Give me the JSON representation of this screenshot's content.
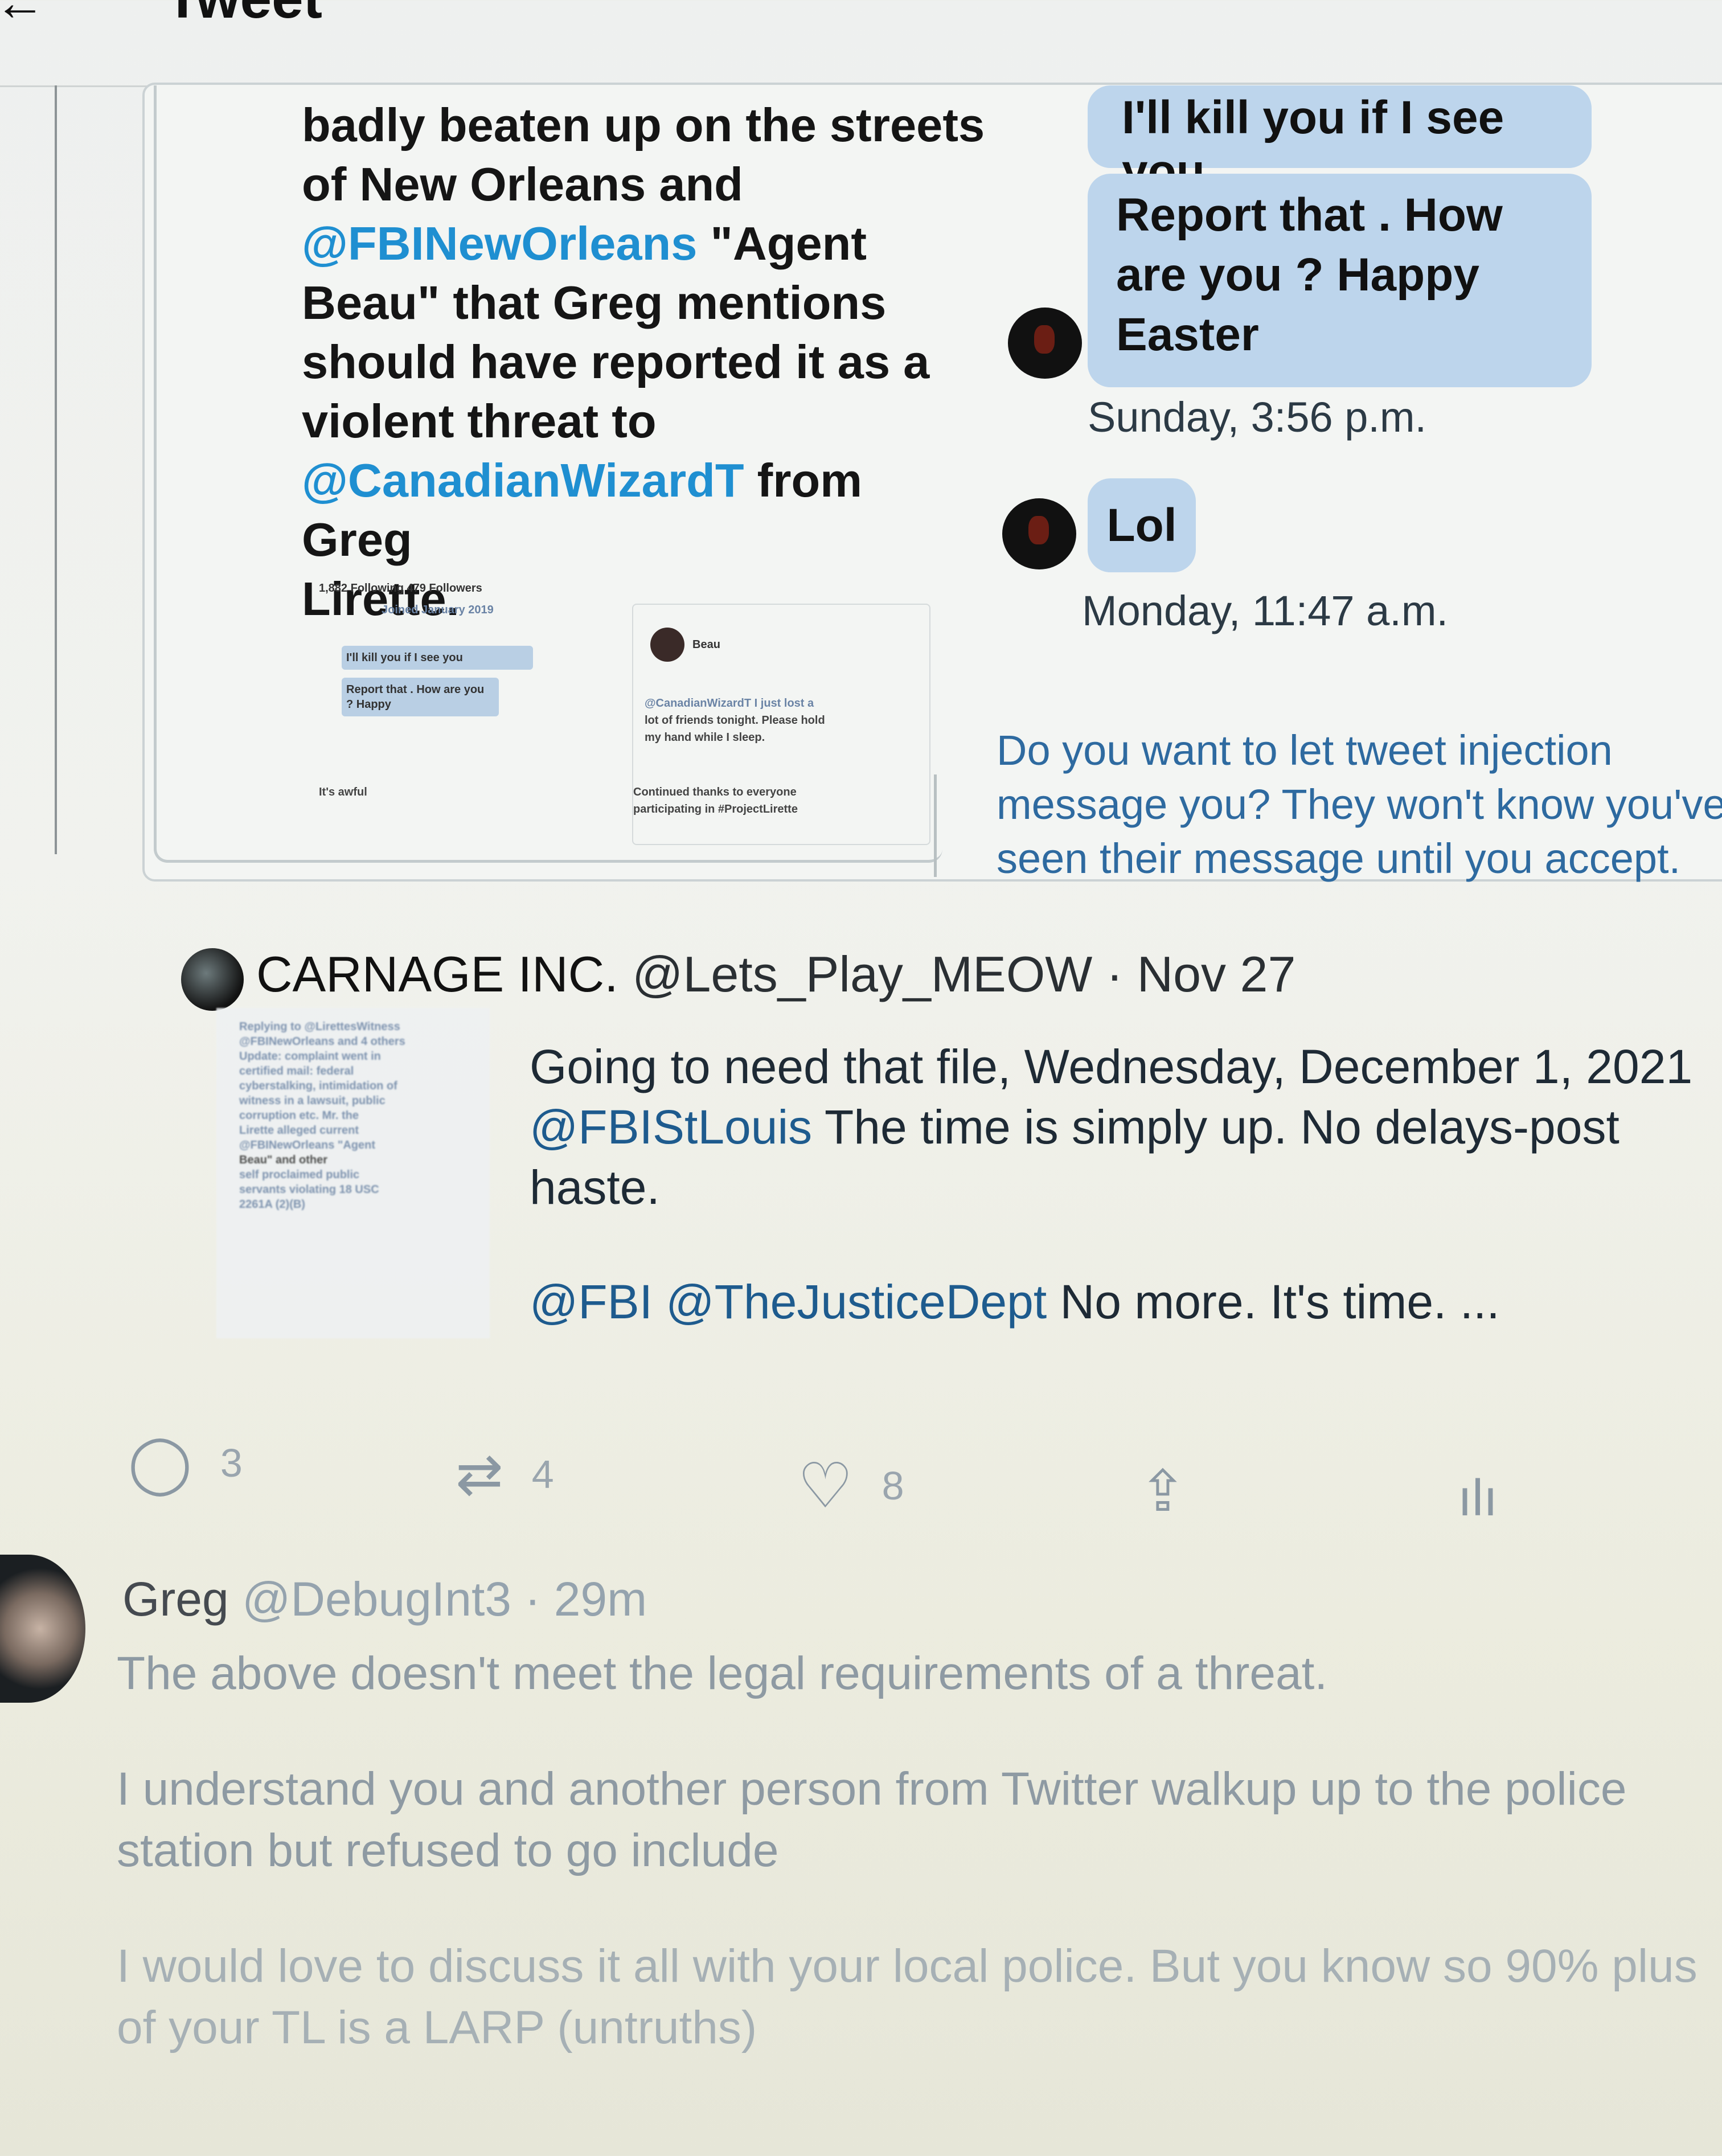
{
  "header": {
    "title": "Tweet",
    "back_icon": "←"
  },
  "embedded_tweet": {
    "text_lines": [
      "badly beaten up on the streets",
      "of New Orleans and",
      [
        "@FBINewOrleans",
        " \"Agent"
      ],
      "Beau\" that Greg mentions",
      "should have reported it as a",
      "violent threat to",
      [
        "@CanadianWizardT",
        " from Greg"
      ],
      "Lirette."
    ],
    "mention_color": "#1f8fd1"
  },
  "dm": {
    "bubble_top": "I'll kill you if I see you",
    "bubble_report": "Report that . How are you ? Happy Easter",
    "time_1": "Sunday, 3:56 p.m.",
    "bubble_lol": "Lol",
    "time_2": "Monday, 11:47 a.m.",
    "prompt": "Do you want to let tweet injection message you? They won't know you've seen their message until you accept."
  },
  "thumbnails": {
    "left": {
      "stats": "1,882 Following 479 Followers",
      "joined": "Joined January 2019",
      "msg1": "I'll kill you if I see you",
      "msg2": "Report that . How are you ? Happy",
      "caption": "It's awful"
    },
    "right": {
      "user": "Beau",
      "line1": "@CanadianWizardT I just lost a",
      "line2": "lot of friends tonight. Please hold",
      "line3": "my hand while I sleep.",
      "footer1": "Continued thanks to everyone",
      "footer2": "participating in #ProjectLirette"
    }
  },
  "tweet": {
    "author": "CARNAGE INC.",
    "handle": "@Lets_Play_MEOW",
    "separator": "·",
    "date": "Nov 27",
    "paragraph_1_a": "Going to need that file, Wednesday, December 1, 2021",
    "paragraph_1_mention": "@FBIStLouis",
    "paragraph_1_b": " The time is simply up. No delays-post haste.",
    "paragraph_2_mention_1": "@FBI",
    "paragraph_2_mention_2": "@TheJusticeDept",
    "paragraph_2_b": " No more. It's time. ...",
    "quoted_preview_lines": [
      "Replying to @LirettesWitness",
      "@FBINewOrleans and 4 others",
      "Update: complaint went in",
      "certified mail: federal",
      "cyberstalking, intimidation of",
      "witness in a lawsuit, public",
      "corruption etc. Mr. the",
      "Lirette alleged current",
      "@FBINewOrleans \"Agent",
      "Beau\" and other",
      "self proclaimed public",
      "servants violating 18 USC",
      "2261A (2)(B)"
    ]
  },
  "actions": {
    "reply_count": "3",
    "retweet_count": "4",
    "like_count": "8",
    "reply_icon": "◯",
    "retweet_icon": "⇄",
    "like_icon": "♡",
    "share_icon": "⇪",
    "analytics_icon": "ılı"
  },
  "reply": {
    "name": "Greg",
    "handle": "@DebugInt3",
    "separator": "·",
    "time": "29m",
    "p1": "The above doesn't meet the legal requirements of a threat.",
    "p2": "I understand you and another person from Twitter walkup up to the police station but refused to go include",
    "p3": "I would love to discuss it all with your local police. But you know so 90% plus of your TL is a LARP (untruths)"
  }
}
